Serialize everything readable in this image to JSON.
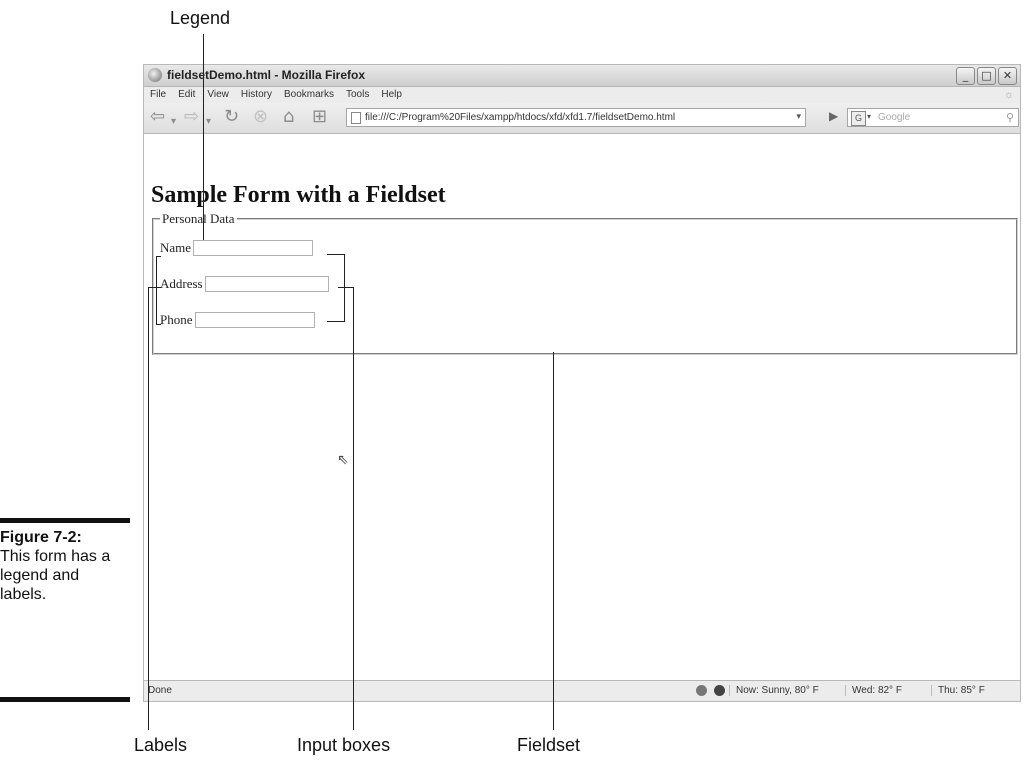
{
  "callouts": {
    "legend": "Legend",
    "labels": "Labels",
    "input_boxes": "Input boxes",
    "fieldset": "Fieldset"
  },
  "figure": {
    "number": "Figure 7-2:",
    "caption": "This form has a legend and labels."
  },
  "window": {
    "title": "fieldsetDemo.html - Mozilla Firefox",
    "minimize": "_",
    "maximize": "□",
    "close": "✕"
  },
  "menu": [
    "File",
    "Edit",
    "View",
    "History",
    "Bookmarks",
    "Tools",
    "Help"
  ],
  "navbar": {
    "url": "file:///C:/Program%20Files/xampp/htdocs/xfd/xfd1.7/fieldsetDemo.html",
    "search_placeholder": "Google"
  },
  "page": {
    "heading": "Sample Form with a Fieldset",
    "legend": "Personal Data",
    "fields": {
      "name": "Name",
      "address": "Address",
      "phone": "Phone"
    }
  },
  "statusbar": {
    "status": "Done",
    "weather_now": "Now: Sunny, 80° F",
    "weather_wed": "Wed: 82° F",
    "weather_thu": "Thu: 85° F"
  }
}
